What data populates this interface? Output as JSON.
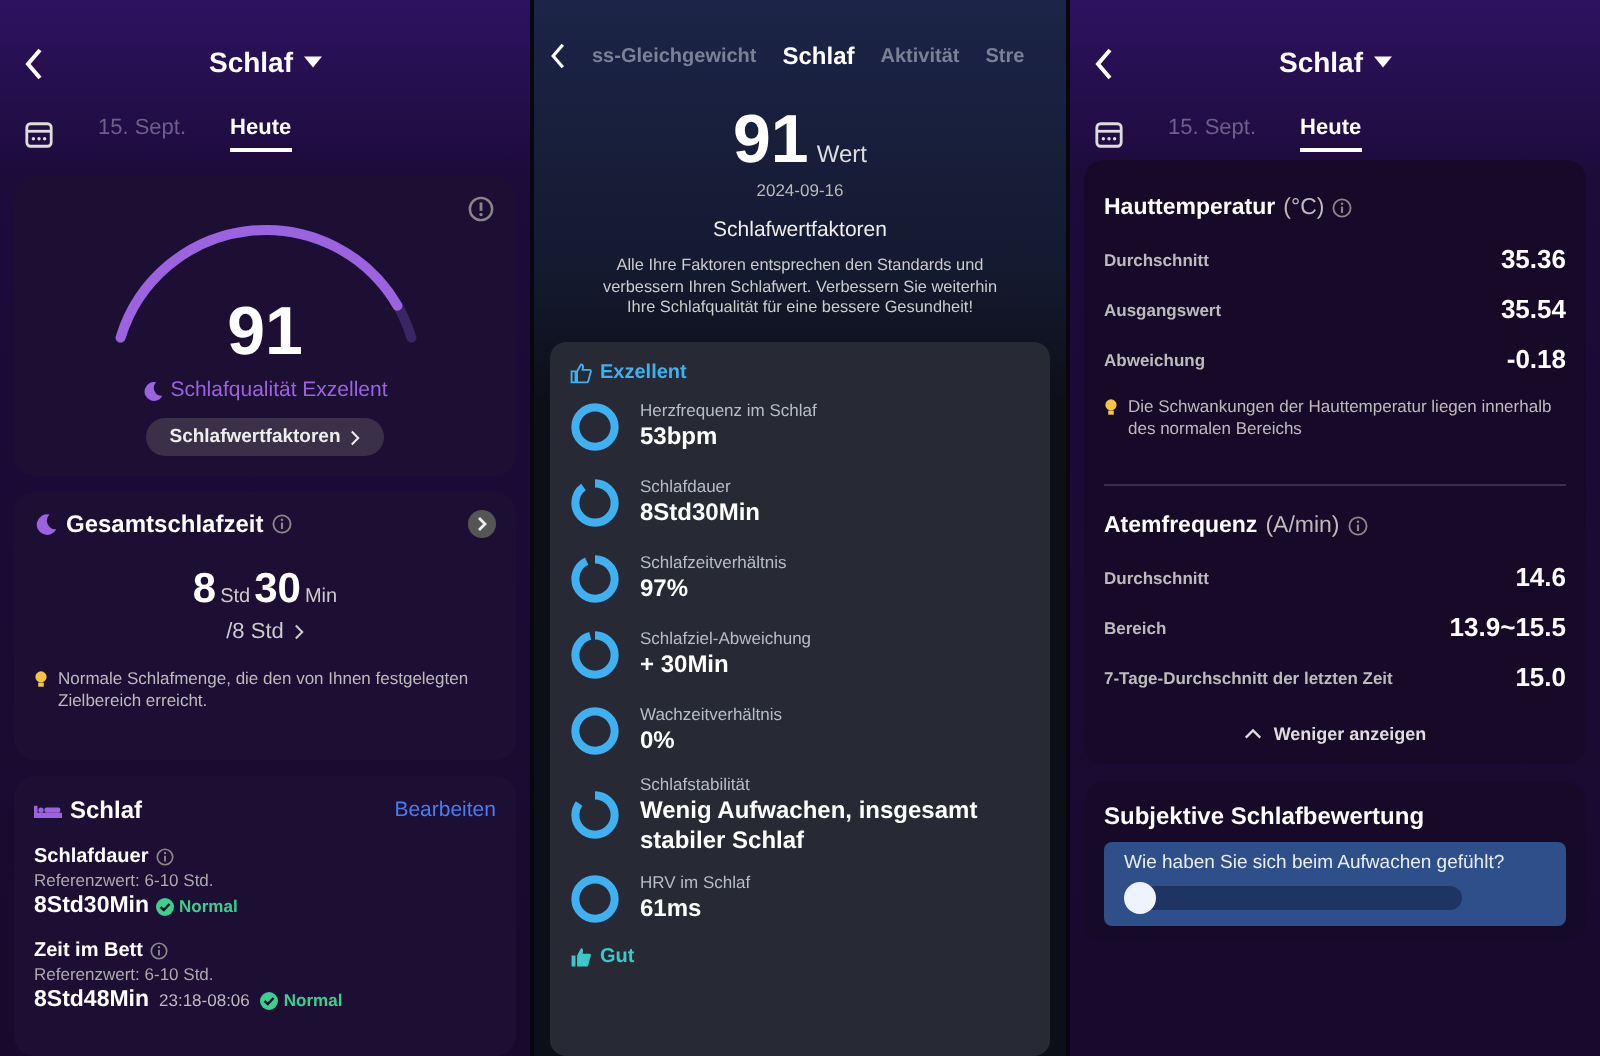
{
  "left_screen": {
    "header": {
      "title": "Schlaf"
    },
    "tabs": [
      {
        "label": "15. Sept.",
        "selected": false
      },
      {
        "label": "Heute",
        "selected": true
      }
    ],
    "score_card": {
      "score": "91",
      "level": 0.91,
      "quality": "Schlafqualität Exzellent",
      "button": "Schlafwertfaktoren"
    },
    "total_sleep": {
      "title": "Gesamtschlafzeit",
      "hours": "8",
      "hours_unit": "Std",
      "minutes": "30",
      "minutes_unit": "Min",
      "goal": "/8 Std",
      "tip": "Normale Schlafmenge, die den von Ihnen festgelegten Zielbereich erreicht."
    },
    "sleep_card": {
      "title": "Schlaf",
      "edit_link": "Bearbeiten",
      "metrics": [
        {
          "label": "Schlafdauer",
          "reference": "Referenzwert: 6-10 Std.",
          "value": "8Std30Min",
          "status": "Normal"
        },
        {
          "label": "Zeit im Bett",
          "reference": "Referenzwert: 6-10 Std.",
          "value": "8Std48Min",
          "time_range": "23:18-08:06",
          "status": "Normal"
        }
      ]
    }
  },
  "middle_screen": {
    "tabs": [
      {
        "label": "ss-Gleichgewicht",
        "selected": false
      },
      {
        "label": "Schlaf",
        "selected": true
      },
      {
        "label": "Aktivität",
        "selected": false
      },
      {
        "label": "Stre",
        "selected": false
      }
    ],
    "score": "91",
    "score_unit": "Wert",
    "date": "2024-09-16",
    "title": "Schlafwertfaktoren",
    "description": "Alle Ihre Faktoren entsprechen den Standards und verbessern Ihren Schlafwert. Verbessern Sie weiterhin Ihre Schlafqualität für eine bessere Gesundheit!",
    "groups": [
      {
        "title": "Exzellent",
        "kind": "excellent",
        "factors": [
          {
            "label": "Herzfrequenz im Schlaf",
            "value": "53bpm",
            "level": 1
          },
          {
            "label": "Schlafdauer",
            "value": "8Std30Min",
            "level": 0.9
          },
          {
            "label": "Schlafzeitverhältnis",
            "value": "97%",
            "level": 0.93
          },
          {
            "label": "Schlafziel-Abweichung",
            "value": "+ 30Min",
            "level": 0.96
          },
          {
            "label": "Wachzeitverhältnis",
            "value": "0%",
            "level": 1
          },
          {
            "label": "Schlafstabilität",
            "value": "Wenig Aufwachen, insgesamt stabiler Schlaf",
            "level": 0.85
          },
          {
            "label": "HRV im Schlaf",
            "value": "61ms",
            "level": 1
          }
        ]
      },
      {
        "title": "Gut",
        "kind": "good"
      }
    ]
  },
  "right_screen": {
    "header": {
      "title": "Schlaf"
    },
    "tabs": [
      {
        "label": "15. Sept.",
        "selected": false
      },
      {
        "label": "Heute",
        "selected": true
      }
    ],
    "skin_temperature": {
      "title": "Hauttemperatur",
      "unit": "(°C)",
      "rows": [
        {
          "label": "Durchschnitt",
          "value": "35.36"
        },
        {
          "label": "Ausgangswert",
          "value": "35.54"
        },
        {
          "label": "Abweichung",
          "value": "-0.18"
        }
      ],
      "tip": "Die Schwankungen der Hauttemperatur liegen innerhalb des normalen Bereichs"
    },
    "respiration": {
      "title": "Atemfrequenz",
      "unit": "(A/min)",
      "rows": [
        {
          "label": "Durchschnitt",
          "value": "14.6"
        },
        {
          "label": "Bereich",
          "value": "13.9~15.5"
        },
        {
          "label": "7-Tage-Durchschnitt der letzten Zeit",
          "value": "15.0"
        }
      ]
    },
    "collapse_button": "Weniger anzeigen",
    "rating": {
      "title": "Subjektive Schlafbewertung",
      "question": "Wie haben Sie sich beim Aufwachen gefühlt?",
      "level": 0
    }
  }
}
